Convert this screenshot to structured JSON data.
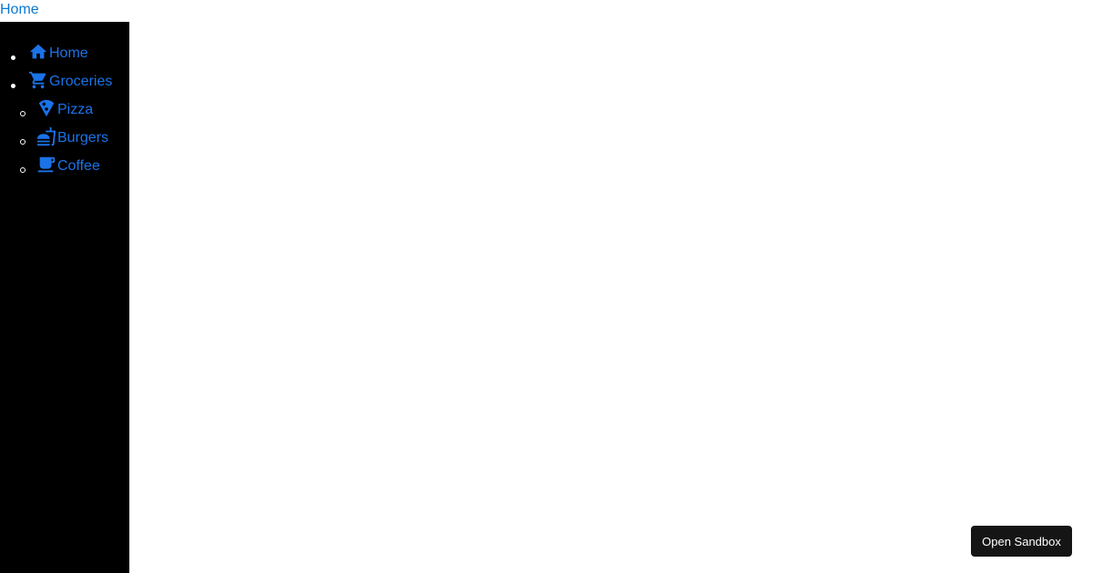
{
  "top_link": {
    "label": "Home"
  },
  "sidebar": {
    "items": [
      {
        "label": "Home",
        "icon": "home-icon",
        "level": 1
      },
      {
        "label": "Groceries",
        "icon": "shopping-cart-icon",
        "level": 1
      },
      {
        "label": "Pizza",
        "icon": "pizza-icon",
        "level": 2
      },
      {
        "label": "Burgers",
        "icon": "burger-icon",
        "level": 2
      },
      {
        "label": "Coffee",
        "icon": "coffee-icon",
        "level": 2
      }
    ]
  },
  "sandbox_button": {
    "label": "Open Sandbox"
  },
  "colors": {
    "link": "#1a73e8",
    "sidebar_bg": "#000000",
    "button_bg": "#151515"
  }
}
